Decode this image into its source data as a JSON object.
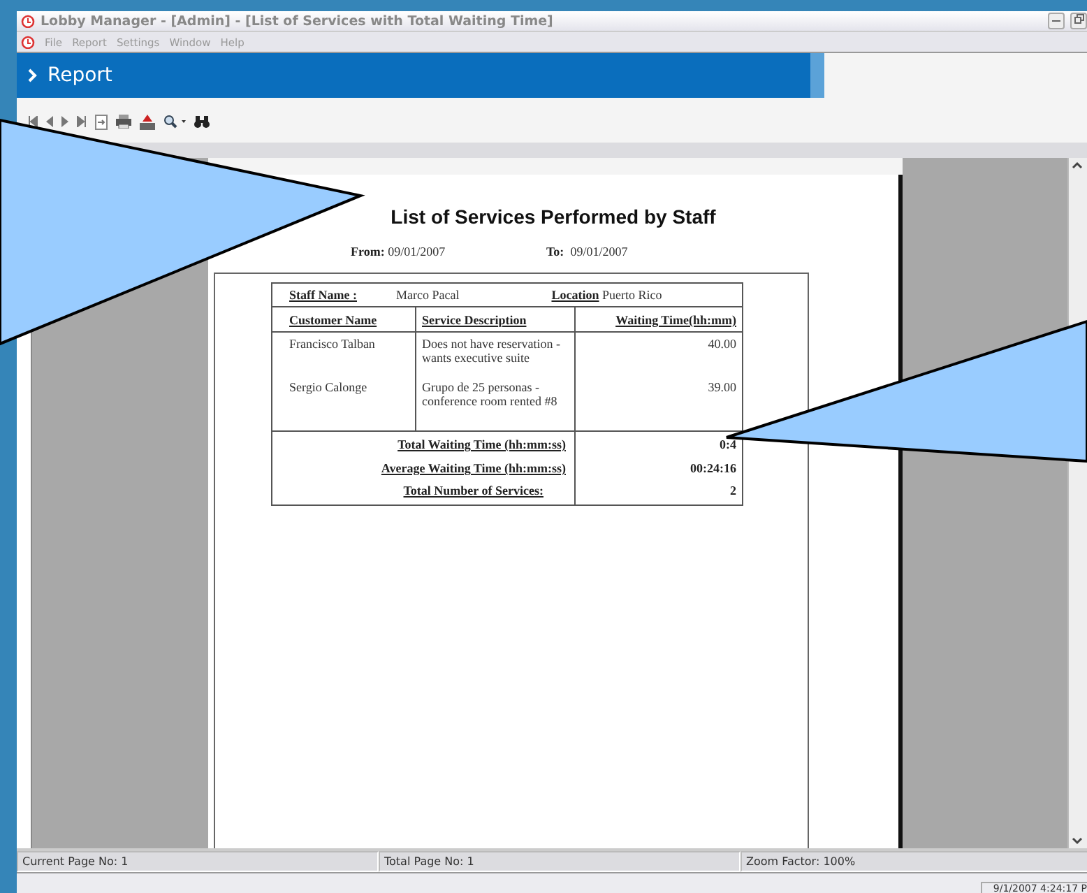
{
  "window": {
    "title": "Lobby Manager - [Admin]  - [List of Services with Total Waiting Time]"
  },
  "menu": [
    "File",
    "Report",
    "Settings",
    "Window",
    "Help"
  ],
  "banner": {
    "title": "Report"
  },
  "report": {
    "title": "List of Services Performed by Staff",
    "from_label": "From:",
    "from": "09/01/2007",
    "to_label": "To:",
    "to": "09/01/2007",
    "staff_label": "Staff Name :",
    "staff": "Marco Pacal",
    "location_label": "Location",
    "location": "Puerto Rico",
    "columns": [
      "Customer Name",
      "Service Description",
      "Waiting Time(hh:mm)"
    ],
    "rows": [
      {
        "customer": "Francisco Talban",
        "service": "Does not have reservation - wants executive suite",
        "time": "40.00"
      },
      {
        "customer": "Sergio Calonge",
        "service": "Grupo de 25 personas - conference room rented #8",
        "time": "39.00"
      }
    ],
    "totals": [
      {
        "label": "Total Waiting Time (hh:mm:ss)",
        "value": "0:4"
      },
      {
        "label": "Average Waiting Time (hh:mm:ss)",
        "value": "00:24:16"
      },
      {
        "label": "Total Number of Services:",
        "value": "2"
      }
    ]
  },
  "status_bar": [
    "Current Page No: 1",
    "Total Page No: 1",
    "Zoom Factor: 100%"
  ],
  "clock": "9/1/2007 4:24:17 P"
}
